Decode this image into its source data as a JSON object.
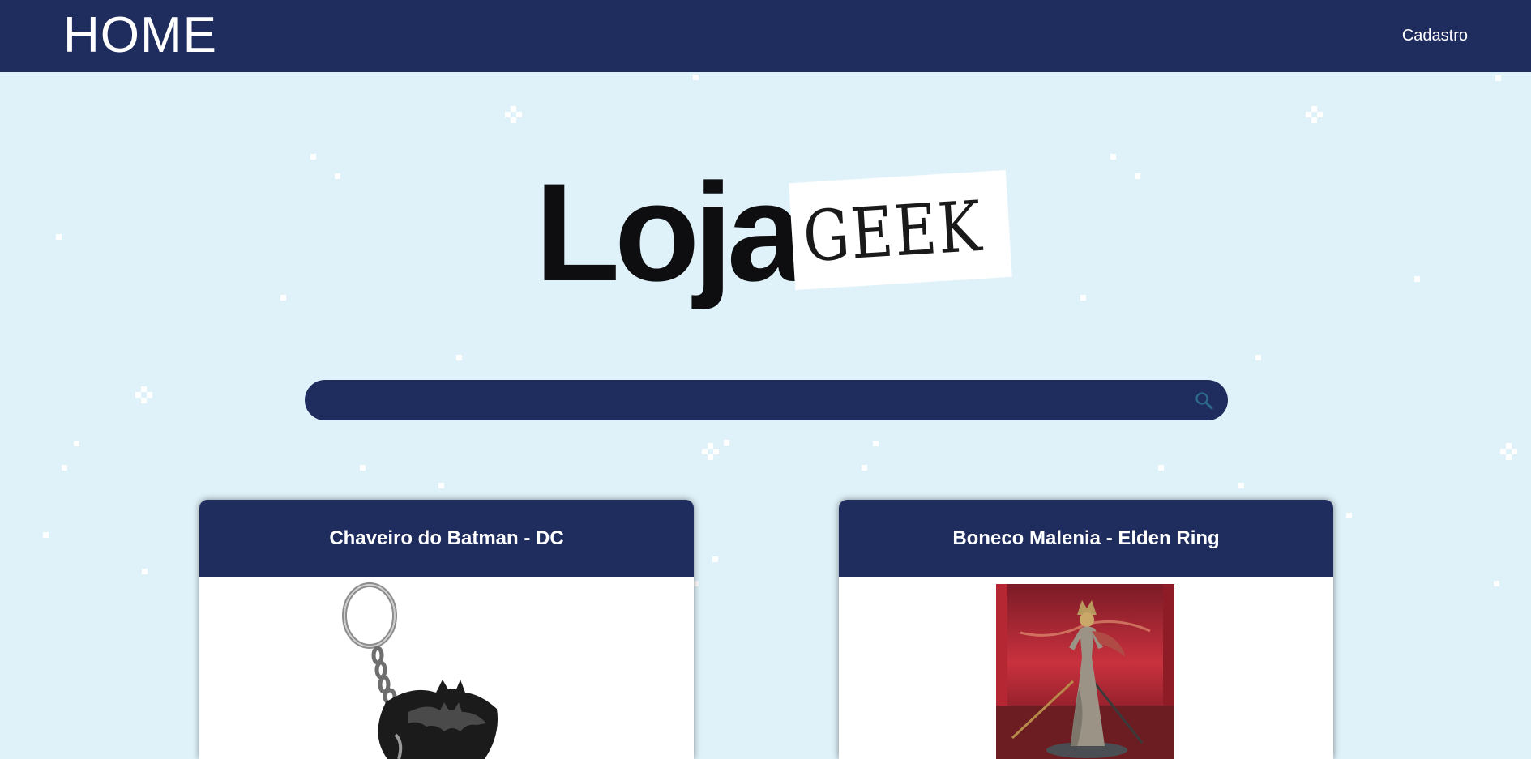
{
  "header": {
    "title": "HOME",
    "nav_link": "Cadastro"
  },
  "logo": {
    "word_main": "Loja",
    "word_tag": "GEEK"
  },
  "search": {
    "value": "",
    "placeholder": "",
    "icon": "search-icon"
  },
  "products": [
    {
      "title": "Chaveiro do Batman - DC",
      "image": "batman-keychain-image"
    },
    {
      "title": "Boneco Malenia - Elden Ring",
      "image": "malenia-figure-image"
    }
  ],
  "colors": {
    "navy": "#1f2c5e",
    "background": "#dff2f9",
    "text_light": "#ffffff"
  }
}
